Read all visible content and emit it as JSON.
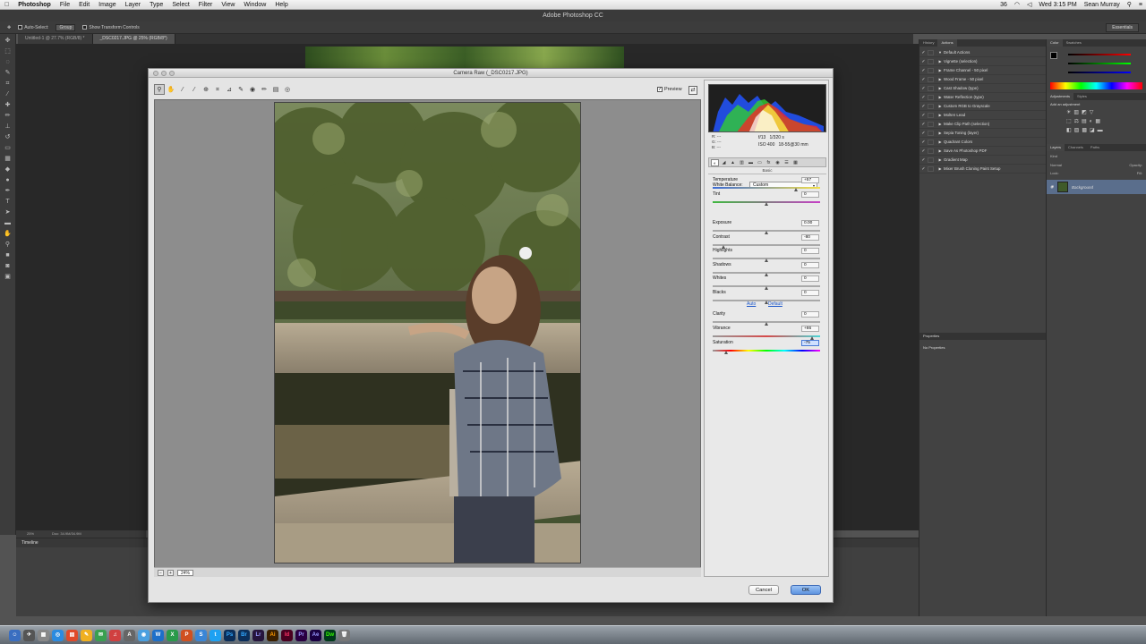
{
  "menubar": {
    "apple": "",
    "app": "Photoshop",
    "items": [
      "File",
      "Edit",
      "Image",
      "Layer",
      "Type",
      "Select",
      "Filter",
      "View",
      "Window",
      "Help"
    ],
    "status_num": "36",
    "clock": "Wed 3:15 PM",
    "user": "Sean Murray"
  },
  "ps": {
    "title": "Adobe Photoshop CC",
    "options": {
      "auto_select": "Auto-Select:",
      "group": "Group",
      "transform": "Show Transform Controls"
    },
    "workspace": "Essentials",
    "tabs": [
      "Untitled-1 @ 27.7% (RGB/8) *",
      "_DSC0217.JPG @ 25% (RGB/8*)"
    ],
    "status_zoom": "25%",
    "status_doc": "Doc: 34.9M/34.9M",
    "timeline": "Timeline"
  },
  "panels": {
    "top_tabs": [
      "History",
      "Actions"
    ],
    "actions": [
      {
        "label": "Default Actions",
        "arrow": "▼"
      },
      {
        "label": "Vignette (selection)",
        "arrow": "▶"
      },
      {
        "label": "Frame Channel - 50 pixel",
        "arrow": "▶"
      },
      {
        "label": "Wood Frame - 50 pixel",
        "arrow": "▶"
      },
      {
        "label": "Cast Shadow (type)",
        "arrow": "▶"
      },
      {
        "label": "Water Reflection (type)",
        "arrow": "▶"
      },
      {
        "label": "Custom RGB to Grayscale",
        "arrow": "▶"
      },
      {
        "label": "Molten Lead",
        "arrow": "▶"
      },
      {
        "label": "Make Clip Path (selection)",
        "arrow": "▶"
      },
      {
        "label": "Sepia Toning (layer)",
        "arrow": "▶"
      },
      {
        "label": "Quadrant Colors",
        "arrow": "▶"
      },
      {
        "label": "Save As Photoshop PDF",
        "arrow": "▶"
      },
      {
        "label": "Gradient Map",
        "arrow": "▶"
      },
      {
        "label": "Mixer Brush Cloning Paint Setup",
        "arrow": "▶"
      }
    ],
    "properties_tab": "Properties",
    "no_properties": "No Properties",
    "color_tabs": [
      "Color",
      "Swatches"
    ],
    "adj_tabs": [
      "Adjustments",
      "Styles"
    ],
    "add_adjustment": "Add an adjustment",
    "layer_tabs": [
      "Layers",
      "Channels",
      "Paths"
    ],
    "layer_kind": "Kind",
    "layer_mode": "Normal",
    "opacity": "Opacity:",
    "lock": "Lock:",
    "fill": "Fill:",
    "layer_name": "Background"
  },
  "camera_raw": {
    "title": "Camera Raw (_DSC0217.JPG)",
    "preview_label": "Preview",
    "preview_check": "✓",
    "zoom": "24%",
    "cam_rgb": [
      "R:   ---",
      "G:   ---",
      "B:   ---"
    ],
    "exposure_info": {
      "aperture": "f/13",
      "shutter": "1/320 s",
      "iso": "ISO 400",
      "lens": "18-55@30 mm"
    },
    "panel_title": "Basic",
    "white_balance": {
      "label": "White Balance:",
      "value": "Custom"
    },
    "sliders": [
      {
        "label": "Temperature",
        "value": "+57",
        "level": 0.78
      },
      {
        "label": "Tint",
        "value": "0",
        "level": 0.5
      },
      {
        "label": "Exposure",
        "value": "0.00",
        "level": 0.5
      },
      {
        "label": "Contrast",
        "value": "-80",
        "level": 0.1
      },
      {
        "label": "Highlights",
        "value": "0",
        "level": 0.5
      },
      {
        "label": "Shadows",
        "value": "0",
        "level": 0.5
      },
      {
        "label": "Whites",
        "value": "0",
        "level": 0.5
      },
      {
        "label": "Blacks",
        "value": "0",
        "level": 0.5
      },
      {
        "label": "Clarity",
        "value": "0",
        "level": 0.5
      },
      {
        "label": "Vibrance",
        "value": "+86",
        "level": 0.93
      },
      {
        "label": "Saturation",
        "value": "-75",
        "level": 0.13
      }
    ],
    "auto_label": "Auto",
    "default_label": "Default",
    "cancel": "Cancel",
    "ok": "OK"
  },
  "icons": {
    "zoom": "🔍",
    "hand": "✋",
    "eyedropper": "⁄",
    "close": "✕"
  },
  "colors": {
    "ok_blue": "#5e94e0",
    "link_blue": "#1a55c8",
    "ps_dark": "#535353"
  }
}
